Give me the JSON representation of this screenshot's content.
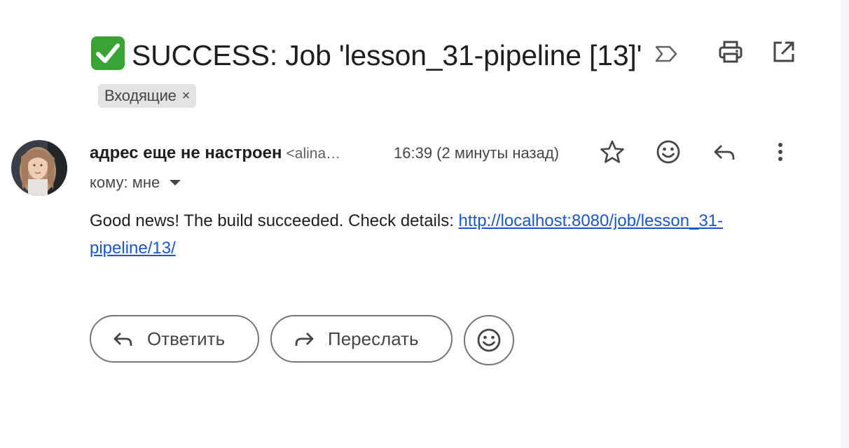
{
  "subject": {
    "text": "SUCCESS: Job 'lesson_31-pipeline [13]'",
    "status_icon": "green-check-emoji",
    "importance_icon": "importance-marker-icon",
    "label": "Входящие",
    "label_remove": "×"
  },
  "header_actions": [
    "print-icon",
    "open-in-new-window-icon"
  ],
  "sender": {
    "name": "адрес еще не настроен",
    "email": "<alina…",
    "time": "16:39 (2 минуты назад)",
    "to": "кому: мне"
  },
  "message_actions": [
    "star-icon",
    "emoji-reaction-icon",
    "reply-icon",
    "more-vert-icon"
  ],
  "body": {
    "text": "Good news! The build succeeded. Check details: ",
    "link": "http://localhost:8080/job/lesson_31-pipeline/13/"
  },
  "footer": {
    "reply_label": "Ответить",
    "forward_label": "Переслать",
    "emoji_button": "emoji-reaction-icon"
  },
  "colors": {
    "link": "#1a56cf",
    "check_green": "#3aa335",
    "chip_bg": "#e3e3e3",
    "text": "#1f1f1f",
    "muted": "#444746"
  }
}
